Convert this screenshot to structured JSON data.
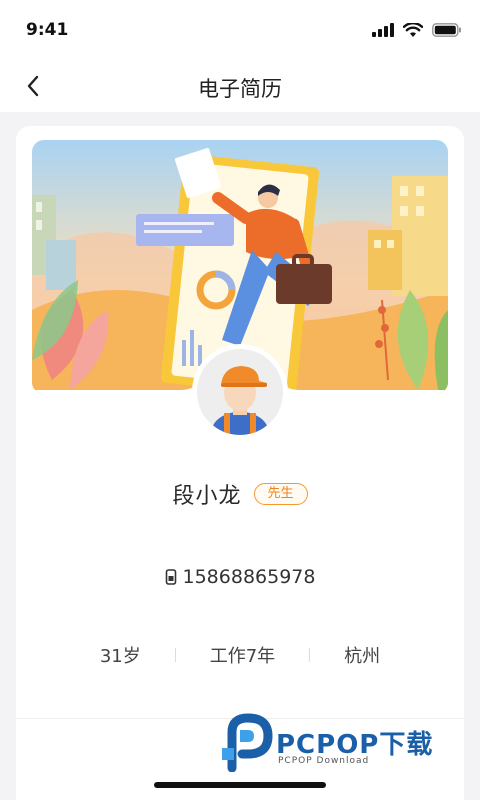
{
  "status_bar": {
    "time": "9:41"
  },
  "nav": {
    "title": "电子简历"
  },
  "profile": {
    "name": "段小龙",
    "gender_badge": "先生",
    "phone": "15868865978",
    "age": "31岁",
    "experience": "工作7年",
    "city": "杭州"
  },
  "watermark": {
    "brand": "PCPOP下载",
    "sub": "PCPOP Download"
  },
  "colors": {
    "accent": "#f0841a",
    "brand_blue": "#1a5fa8"
  }
}
